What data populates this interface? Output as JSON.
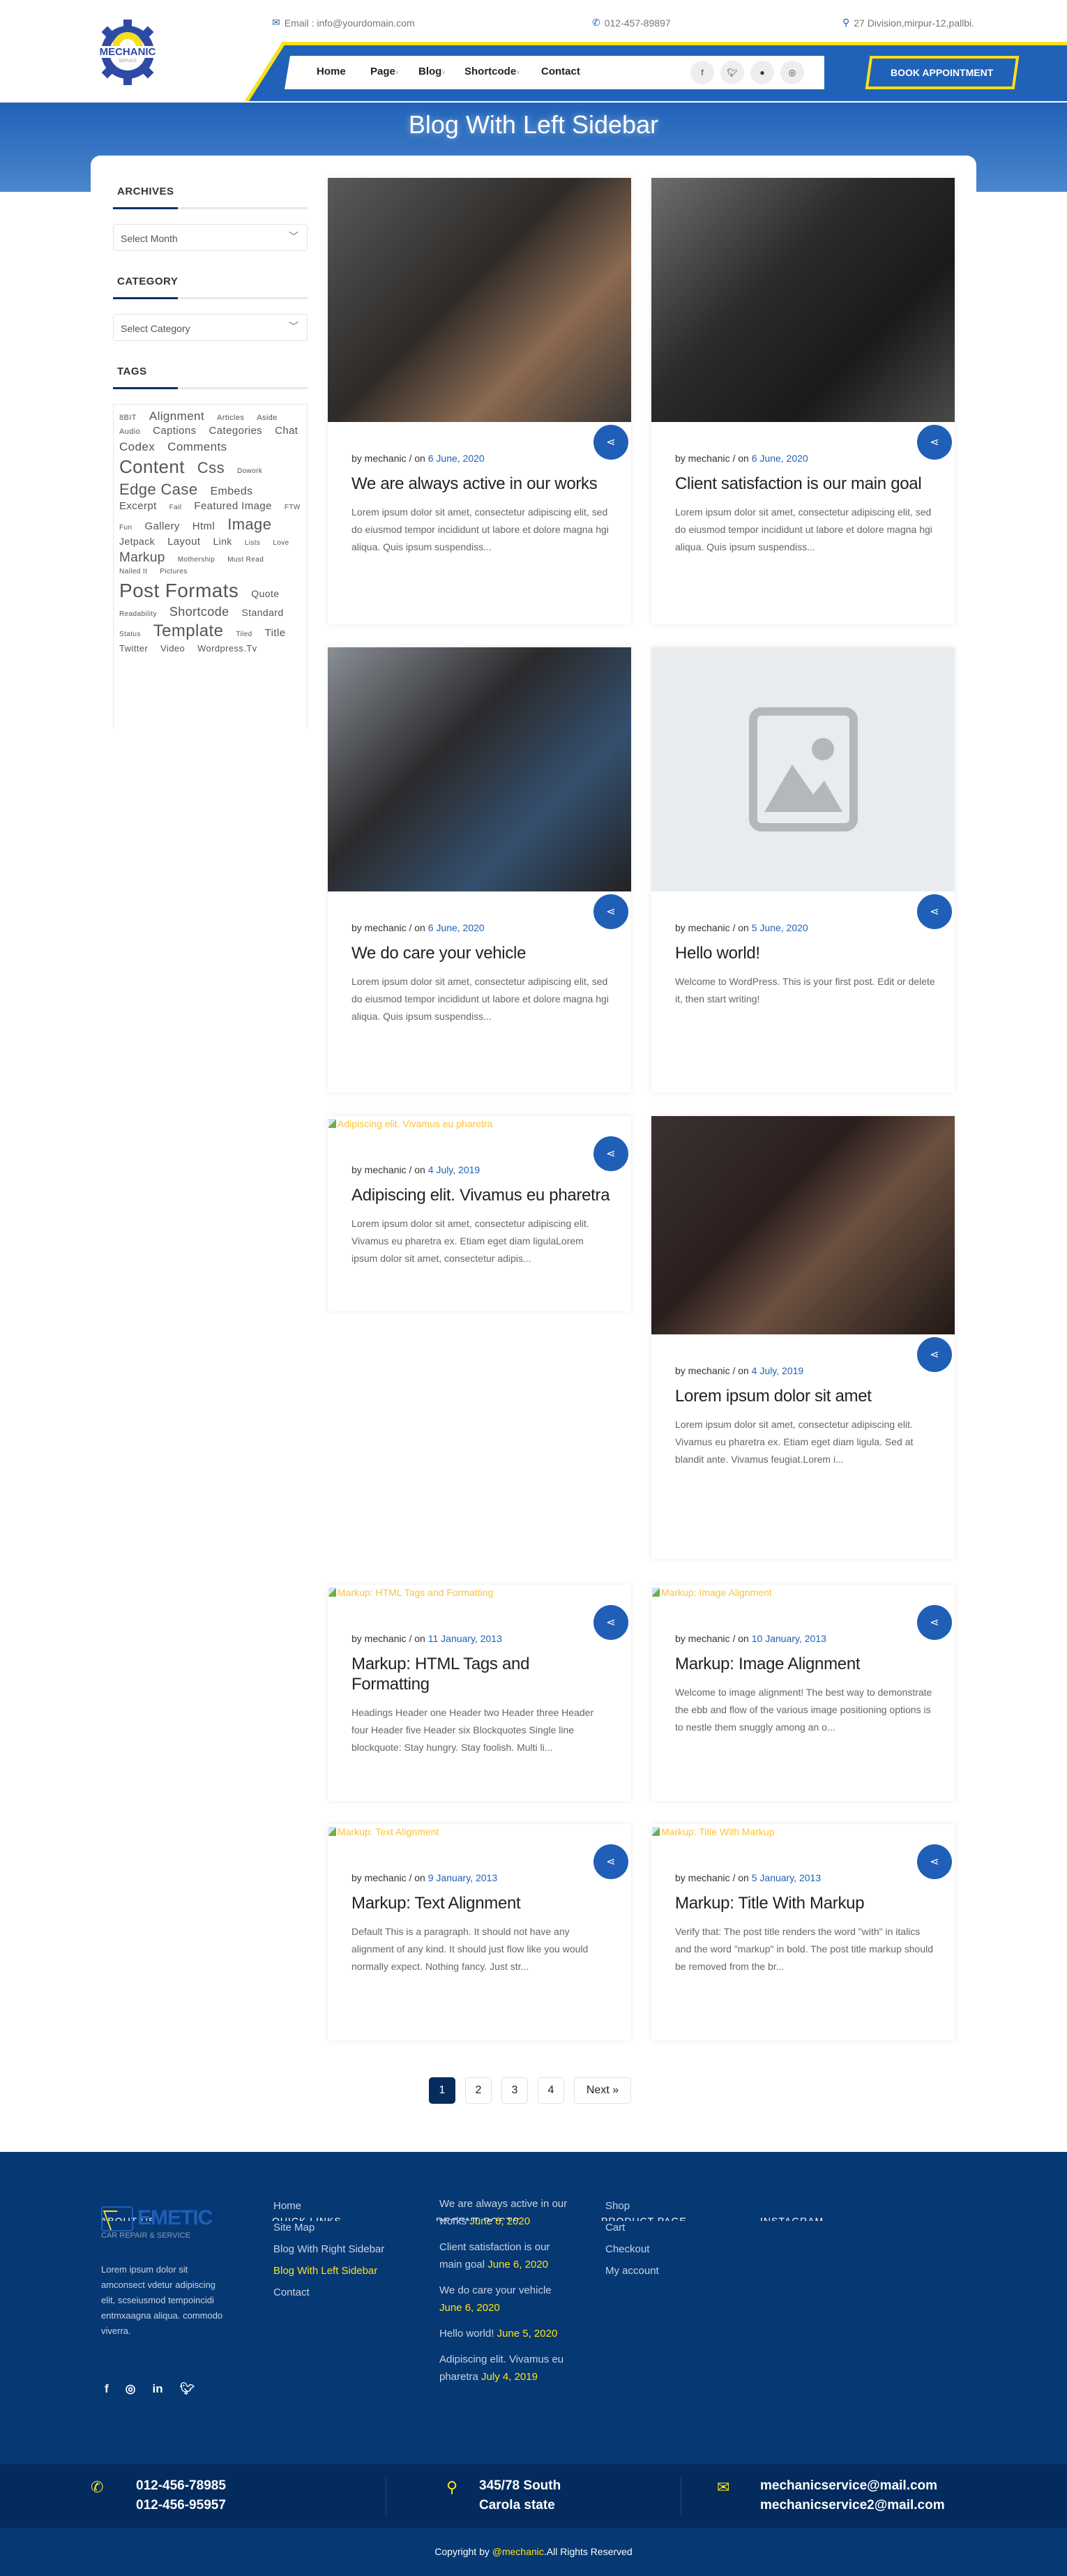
{
  "header": {
    "logo": {
      "text": "MECHANIC",
      "sub": "SERVICE"
    },
    "email": "Email : info@yourdomain.com",
    "phone": "012-457-89897",
    "address": "27 Division,mirpur-12,pallbi.",
    "nav": [
      {
        "label": "Home",
        "dropdown": false
      },
      {
        "label": "Page",
        "dropdown": true
      },
      {
        "label": "Blog",
        "dropdown": true
      },
      {
        "label": "Shortcode",
        "dropdown": true
      },
      {
        "label": "Contact",
        "dropdown": false
      }
    ],
    "social": [
      "facebook-icon",
      "twitter-icon",
      "chat-icon",
      "instagram-icon"
    ],
    "book_label": "BOOK APPOINTMENT"
  },
  "hero": {
    "title": "Blog With Left Sidebar"
  },
  "sidebar": {
    "archives": {
      "heading": "ARCHIVES",
      "select": "Select Month"
    },
    "category": {
      "heading": "CATEGORY",
      "select": "Select Category"
    },
    "tags": {
      "heading": "TAGS",
      "items": [
        {
          "label": "8BIT",
          "size": 11
        },
        {
          "label": "Alignment",
          "size": 17
        },
        {
          "label": "Articles",
          "size": 11
        },
        {
          "label": "Aside",
          "size": 11
        },
        {
          "label": "Audio",
          "size": 11
        },
        {
          "label": "Captions",
          "size": 15
        },
        {
          "label": "Categories",
          "size": 15
        },
        {
          "label": "Chat",
          "size": 15
        },
        {
          "label": "Codex",
          "size": 17
        },
        {
          "label": "Comments",
          "size": 17
        },
        {
          "label": "Content",
          "size": 26
        },
        {
          "label": "Css",
          "size": 22
        },
        {
          "label": "Dowork",
          "size": 10
        },
        {
          "label": "Edge Case",
          "size": 22
        },
        {
          "label": "Embeds",
          "size": 16
        },
        {
          "label": "Excerpt",
          "size": 15
        },
        {
          "label": "Fail",
          "size": 10
        },
        {
          "label": "Featured Image",
          "size": 15
        },
        {
          "label": "FTW",
          "size": 10
        },
        {
          "label": "Fun",
          "size": 10
        },
        {
          "label": "Gallery",
          "size": 15
        },
        {
          "label": "Html",
          "size": 15
        },
        {
          "label": "Image",
          "size": 22
        },
        {
          "label": "Jetpack",
          "size": 14
        },
        {
          "label": "Layout",
          "size": 15
        },
        {
          "label": "Link",
          "size": 14
        },
        {
          "label": "Lists",
          "size": 10
        },
        {
          "label": "Love",
          "size": 10
        },
        {
          "label": "Markup",
          "size": 19
        },
        {
          "label": "Mothership",
          "size": 10
        },
        {
          "label": "Must Read",
          "size": 10
        },
        {
          "label": "Nailed It",
          "size": 10
        },
        {
          "label": "Pictures",
          "size": 10
        },
        {
          "label": "Post Formats",
          "size": 28
        },
        {
          "label": "Quote",
          "size": 14
        },
        {
          "label": "Readability",
          "size": 10
        },
        {
          "label": "Shortcode",
          "size": 18
        },
        {
          "label": "Standard",
          "size": 14
        },
        {
          "label": "Status",
          "size": 10
        },
        {
          "label": "Template",
          "size": 24
        },
        {
          "label": "Tiled",
          "size": 10
        },
        {
          "label": "Title",
          "size": 15
        },
        {
          "label": "Twitter",
          "size": 13
        },
        {
          "label": "Video",
          "size": 13
        },
        {
          "label": "Wordpress.Tv",
          "size": 13
        }
      ]
    }
  },
  "posts": [
    {
      "image": "photo",
      "author": "by mechanic / on",
      "date": "6 June, 2020",
      "title": "We are always active in our works",
      "excerpt": "Lorem ipsum dolor sit amet, consectetur adipiscing elit, sed do eiusmod tempor incididunt ut labore et dolore magna hgi aliqua. Quis ipsum suspendiss..."
    },
    {
      "image": "photo",
      "author": "by mechanic / on",
      "date": "6 June, 2020",
      "title": "Client satisfaction is our main goal",
      "excerpt": "Lorem ipsum dolor sit amet, consectetur adipiscing elit, sed do eiusmod tempor incididunt ut labore et dolore magna hgi aliqua. Quis ipsum suspendiss..."
    },
    {
      "image": "photo",
      "author": "by mechanic / on",
      "date": "6 June, 2020",
      "title": "We do care your vehicle",
      "excerpt": "Lorem ipsum dolor sit amet, consectetur adipiscing elit, sed do eiusmod tempor incididunt ut labore et dolore magna hgi aliqua. Quis ipsum suspendiss..."
    },
    {
      "image": "placeholder",
      "author": "by mechanic / on",
      "date": "5 June, 2020",
      "title": "Hello world!",
      "excerpt": "Welcome to WordPress. This is your first post. Edit or delete it, then start writing!"
    },
    {
      "image": "broken",
      "alt": "Adipiscing elit. Vivamus eu pharetra",
      "author": "by mechanic / on",
      "date": "4 July, 2019",
      "title": "Adipiscing elit. Vivamus eu pharetra",
      "excerpt": "Lorem ipsum dolor sit amet, consectetur adipiscing elit. Vivamus eu pharetra ex. Etiam eget diam ligulaLorem ipsum dolor sit amet, consectetur adipis..."
    },
    {
      "image": "photo",
      "author": "by mechanic / on",
      "date": "4 July, 2019",
      "title": "Lorem ipsum dolor sit amet",
      "excerpt": "Lorem ipsum dolor sit amet, consectetur adipiscing elit. Vivamus eu pharetra ex. Etiam eget diam ligula. Sed at blandit ante. Vivamus feugiat.Lorem i..."
    },
    {
      "image": "broken",
      "alt": "Markup: HTML Tags and Formatting",
      "author": "by mechanic / on",
      "date": "11 January, 2013",
      "title": "Markup: HTML Tags and Formatting",
      "excerpt": "Headings Header one Header two Header three Header four Header five Header six Blockquotes Single line blockquote: Stay hungry. Stay foolish. Multi li..."
    },
    {
      "image": "broken",
      "alt": "Markup: Image Alignment",
      "author": "by mechanic / on",
      "date": "10 January, 2013",
      "title": "Markup: Image Alignment",
      "excerpt": "Welcome to image alignment! The best way to demonstrate the ebb and flow of the various image positioning options is to nestle them snuggly among an o..."
    },
    {
      "image": "broken",
      "alt": "Markup: Text Alignment",
      "author": "by mechanic / on",
      "date": "9 January, 2013",
      "title": "Markup: Text Alignment",
      "excerpt": "Default This is a paragraph. It should not have any alignment of any kind. It should just flow like you would normally expect. Nothing fancy. Just str..."
    },
    {
      "image": "broken",
      "alt": "Markup: Title With Markup",
      "author": "by mechanic / on",
      "date": "5 January, 2013",
      "title": "Markup: Title With Markup",
      "excerpt": "Verify that: The post title renders the word \"with\" in italics and the word \"markup\" in bold. The post title markup should be removed from the br..."
    }
  ],
  "pagination": {
    "pages": [
      "1",
      "2",
      "3",
      "4"
    ],
    "current": "1",
    "next": "Next »"
  },
  "footer": {
    "headings": [
      "ABOUT US",
      "QUICK LINKS",
      "RECENT POSTS",
      "PRODUCT PAGE",
      "INSTAGRAM"
    ],
    "logo": {
      "text": "EMETIC",
      "sub": "CAR REPAIR & SERVICE"
    },
    "about": "Lorem ipsum dolor sit amconsect vdetur adipiscing elit, scseiusmod tempoincidi entmxaagna aliqua. commodo viverra.",
    "quick_links": [
      {
        "label": "Home",
        "active": false
      },
      {
        "label": "Site Map",
        "active": false
      },
      {
        "label": "Blog With Right Sidebar",
        "active": false
      },
      {
        "label": "Blog With Left Sidebar",
        "active": true
      },
      {
        "label": "Contact",
        "active": false
      }
    ],
    "recent_posts": [
      {
        "title": "We are always active in our works",
        "date": "June 6, 2020"
      },
      {
        "title": "Client satisfaction is our main goal",
        "date": "June 6, 2020"
      },
      {
        "title": "We do care your vehicle",
        "date": "June 6, 2020"
      },
      {
        "title": "Hello world!",
        "date": "June 5, 2020"
      },
      {
        "title": "Adipiscing elit. Vivamus eu pharetra",
        "date": "July 4, 2019"
      }
    ],
    "product_links": [
      "Shop",
      "Cart",
      "Checkout",
      "My account"
    ],
    "contact": {
      "phones": [
        "012-456-78985",
        "012-456-95957"
      ],
      "address": [
        "345/78 South",
        "Carola state"
      ],
      "emails": [
        "mechanicservice@mail.com",
        "mechanicservice2@mail.com"
      ]
    },
    "copyright": {
      "pre": "Copyright by ",
      "brand": "@mechanic",
      "post": ".All Rights Reserved"
    }
  },
  "colors": {
    "primary": "#2062b8",
    "accent": "#ffe01a",
    "footer": "#063873",
    "date": "#2062b8"
  }
}
